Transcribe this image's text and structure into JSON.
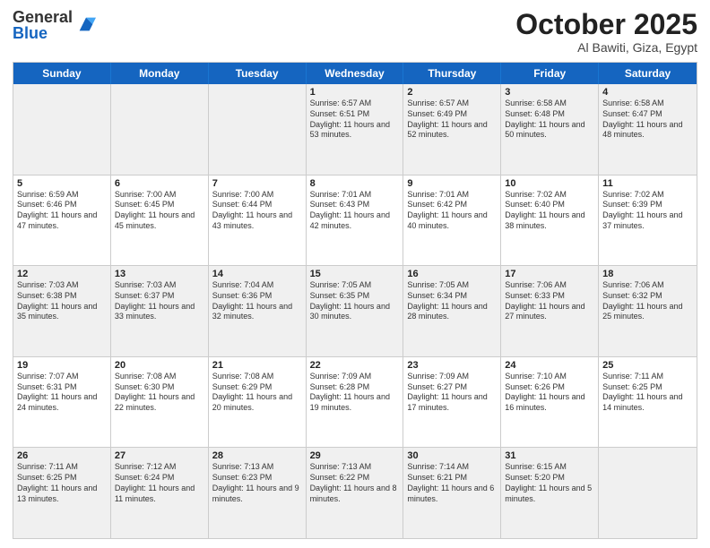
{
  "header": {
    "logo_general": "General",
    "logo_blue": "Blue",
    "month_title": "October 2025",
    "location": "Al Bawiti, Giza, Egypt"
  },
  "days_of_week": [
    "Sunday",
    "Monday",
    "Tuesday",
    "Wednesday",
    "Thursday",
    "Friday",
    "Saturday"
  ],
  "weeks": [
    [
      {
        "day": "",
        "text": ""
      },
      {
        "day": "",
        "text": ""
      },
      {
        "day": "",
        "text": ""
      },
      {
        "day": "1",
        "text": "Sunrise: 6:57 AM\nSunset: 6:51 PM\nDaylight: 11 hours and 53 minutes."
      },
      {
        "day": "2",
        "text": "Sunrise: 6:57 AM\nSunset: 6:49 PM\nDaylight: 11 hours and 52 minutes."
      },
      {
        "day": "3",
        "text": "Sunrise: 6:58 AM\nSunset: 6:48 PM\nDaylight: 11 hours and 50 minutes."
      },
      {
        "day": "4",
        "text": "Sunrise: 6:58 AM\nSunset: 6:47 PM\nDaylight: 11 hours and 48 minutes."
      }
    ],
    [
      {
        "day": "5",
        "text": "Sunrise: 6:59 AM\nSunset: 6:46 PM\nDaylight: 11 hours and 47 minutes."
      },
      {
        "day": "6",
        "text": "Sunrise: 7:00 AM\nSunset: 6:45 PM\nDaylight: 11 hours and 45 minutes."
      },
      {
        "day": "7",
        "text": "Sunrise: 7:00 AM\nSunset: 6:44 PM\nDaylight: 11 hours and 43 minutes."
      },
      {
        "day": "8",
        "text": "Sunrise: 7:01 AM\nSunset: 6:43 PM\nDaylight: 11 hours and 42 minutes."
      },
      {
        "day": "9",
        "text": "Sunrise: 7:01 AM\nSunset: 6:42 PM\nDaylight: 11 hours and 40 minutes."
      },
      {
        "day": "10",
        "text": "Sunrise: 7:02 AM\nSunset: 6:40 PM\nDaylight: 11 hours and 38 minutes."
      },
      {
        "day": "11",
        "text": "Sunrise: 7:02 AM\nSunset: 6:39 PM\nDaylight: 11 hours and 37 minutes."
      }
    ],
    [
      {
        "day": "12",
        "text": "Sunrise: 7:03 AM\nSunset: 6:38 PM\nDaylight: 11 hours and 35 minutes."
      },
      {
        "day": "13",
        "text": "Sunrise: 7:03 AM\nSunset: 6:37 PM\nDaylight: 11 hours and 33 minutes."
      },
      {
        "day": "14",
        "text": "Sunrise: 7:04 AM\nSunset: 6:36 PM\nDaylight: 11 hours and 32 minutes."
      },
      {
        "day": "15",
        "text": "Sunrise: 7:05 AM\nSunset: 6:35 PM\nDaylight: 11 hours and 30 minutes."
      },
      {
        "day": "16",
        "text": "Sunrise: 7:05 AM\nSunset: 6:34 PM\nDaylight: 11 hours and 28 minutes."
      },
      {
        "day": "17",
        "text": "Sunrise: 7:06 AM\nSunset: 6:33 PM\nDaylight: 11 hours and 27 minutes."
      },
      {
        "day": "18",
        "text": "Sunrise: 7:06 AM\nSunset: 6:32 PM\nDaylight: 11 hours and 25 minutes."
      }
    ],
    [
      {
        "day": "19",
        "text": "Sunrise: 7:07 AM\nSunset: 6:31 PM\nDaylight: 11 hours and 24 minutes."
      },
      {
        "day": "20",
        "text": "Sunrise: 7:08 AM\nSunset: 6:30 PM\nDaylight: 11 hours and 22 minutes."
      },
      {
        "day": "21",
        "text": "Sunrise: 7:08 AM\nSunset: 6:29 PM\nDaylight: 11 hours and 20 minutes."
      },
      {
        "day": "22",
        "text": "Sunrise: 7:09 AM\nSunset: 6:28 PM\nDaylight: 11 hours and 19 minutes."
      },
      {
        "day": "23",
        "text": "Sunrise: 7:09 AM\nSunset: 6:27 PM\nDaylight: 11 hours and 17 minutes."
      },
      {
        "day": "24",
        "text": "Sunrise: 7:10 AM\nSunset: 6:26 PM\nDaylight: 11 hours and 16 minutes."
      },
      {
        "day": "25",
        "text": "Sunrise: 7:11 AM\nSunset: 6:25 PM\nDaylight: 11 hours and 14 minutes."
      }
    ],
    [
      {
        "day": "26",
        "text": "Sunrise: 7:11 AM\nSunset: 6:25 PM\nDaylight: 11 hours and 13 minutes."
      },
      {
        "day": "27",
        "text": "Sunrise: 7:12 AM\nSunset: 6:24 PM\nDaylight: 11 hours and 11 minutes."
      },
      {
        "day": "28",
        "text": "Sunrise: 7:13 AM\nSunset: 6:23 PM\nDaylight: 11 hours and 9 minutes."
      },
      {
        "day": "29",
        "text": "Sunrise: 7:13 AM\nSunset: 6:22 PM\nDaylight: 11 hours and 8 minutes."
      },
      {
        "day": "30",
        "text": "Sunrise: 7:14 AM\nSunset: 6:21 PM\nDaylight: 11 hours and 6 minutes."
      },
      {
        "day": "31",
        "text": "Sunrise: 6:15 AM\nSunset: 5:20 PM\nDaylight: 11 hours and 5 minutes."
      },
      {
        "day": "",
        "text": ""
      }
    ]
  ],
  "shaded_rows": [
    0,
    2,
    4
  ]
}
